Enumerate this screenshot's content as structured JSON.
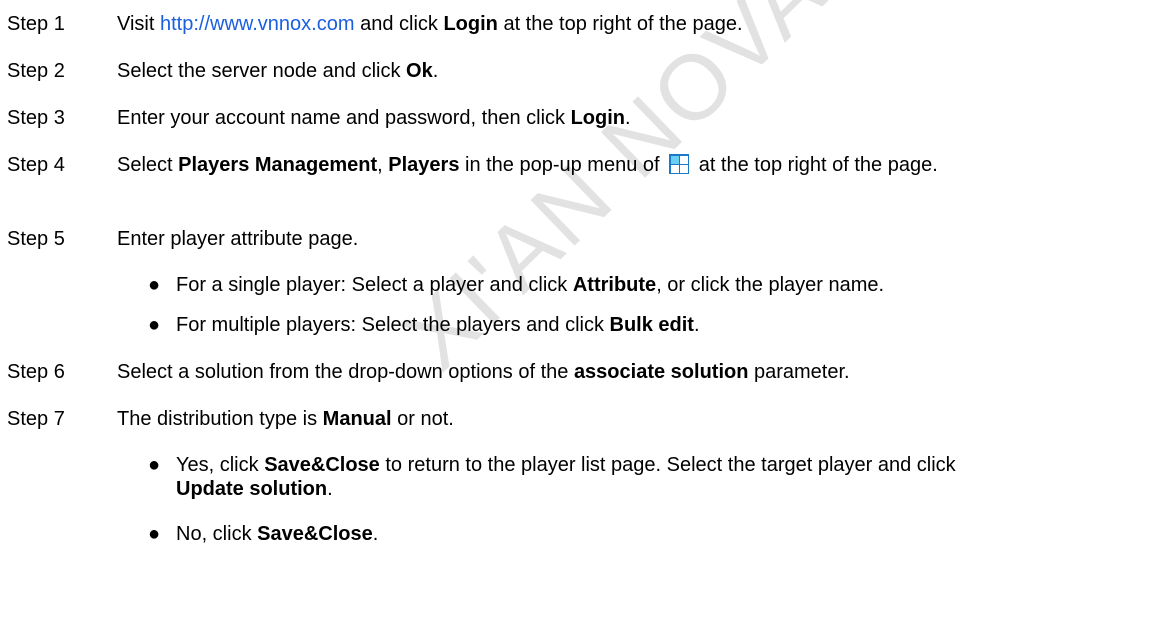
{
  "watermark": "XI'AN NOVASTAR TECH",
  "steps": [
    {
      "num": "Step 1",
      "parts": [
        "Visit ",
        "http://www.vnnox.com",
        " and click ",
        "Login",
        " at the top right of the page."
      ]
    },
    {
      "num": "Step 2",
      "parts": [
        "Select the server node and click ",
        "Ok",
        "."
      ]
    },
    {
      "num": "Step 3",
      "parts": [
        "Enter your account name and password, then click ",
        "Login",
        "."
      ]
    },
    {
      "num": "Step 4",
      "parts": [
        "Select ",
        "Players Management",
        ", ",
        "Players",
        " in the pop-up menu of ",
        " at the top right of the page."
      ]
    },
    {
      "num": "Step 5",
      "parts": [
        "Enter player attribute page."
      ],
      "bullets": [
        {
          "parts": [
            "For a single player: Select a player and click ",
            "Attribute",
            ", or click the player name."
          ]
        },
        {
          "parts": [
            "For multiple players: Select the players and click ",
            "Bulk edit",
            "."
          ]
        }
      ]
    },
    {
      "num": "Step 6",
      "parts": [
        "Select a solution from the drop-down options of the ",
        "associate solution",
        " parameter."
      ]
    },
    {
      "num": "Step 7",
      "parts": [
        "The distribution type is ",
        "Manual",
        " or not."
      ],
      "bullets": [
        {
          "parts": [
            "Yes, click ",
            "Save&Close",
            " to return to the player list page. Select the target player and click ",
            "Update solution",
            "."
          ]
        },
        {
          "parts": [
            "No, click ",
            "Save&Close",
            "."
          ]
        }
      ]
    }
  ],
  "colors": {
    "link": "#1a5fe0",
    "menu_icon": "#1b79c9",
    "watermark": "#e2e2e2"
  },
  "icons": {
    "menu": "grid-menu-icon"
  }
}
